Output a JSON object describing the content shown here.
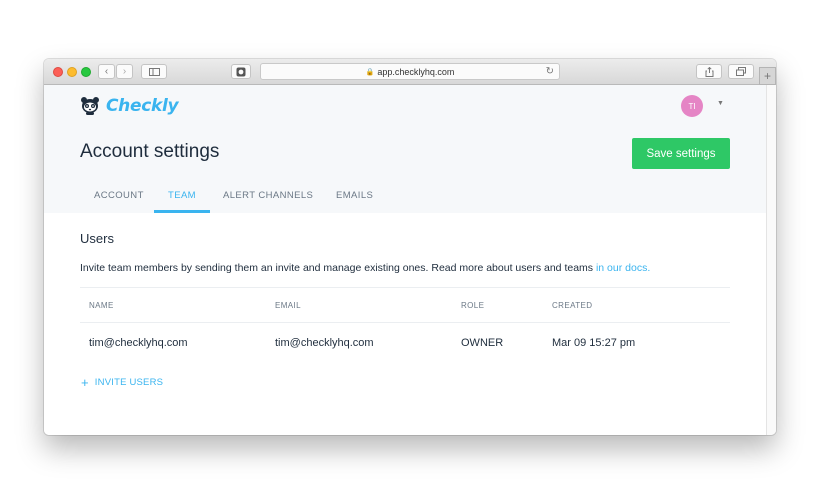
{
  "browser": {
    "url": "app.checklyhq.com"
  },
  "app": {
    "logo_text": "Checkly",
    "avatar_initials": "TI"
  },
  "page": {
    "title": "Account settings",
    "save_label": "Save settings",
    "tabs": [
      {
        "label": "ACCOUNT",
        "active": false
      },
      {
        "label": "TEAM",
        "active": true
      },
      {
        "label": "ALERT CHANNELS",
        "active": false
      },
      {
        "label": "EMAILS",
        "active": false
      }
    ]
  },
  "users": {
    "heading": "Users",
    "description": "Invite team members by sending them an invite and manage existing ones. Read more about users and teams ",
    "docs_link": "in our docs.",
    "columns": [
      "NAME",
      "EMAIL",
      "ROLE",
      "CREATED"
    ],
    "rows": [
      {
        "name": "tim@checklyhq.com",
        "email": "tim@checklyhq.com",
        "role": "OWNER",
        "created": "Mar 09 15:27 pm"
      }
    ],
    "invite_label": "INVITE USERS"
  },
  "colors": {
    "accent": "#3ab4ef",
    "save_button": "#2ec866",
    "avatar": "#e585c5"
  }
}
